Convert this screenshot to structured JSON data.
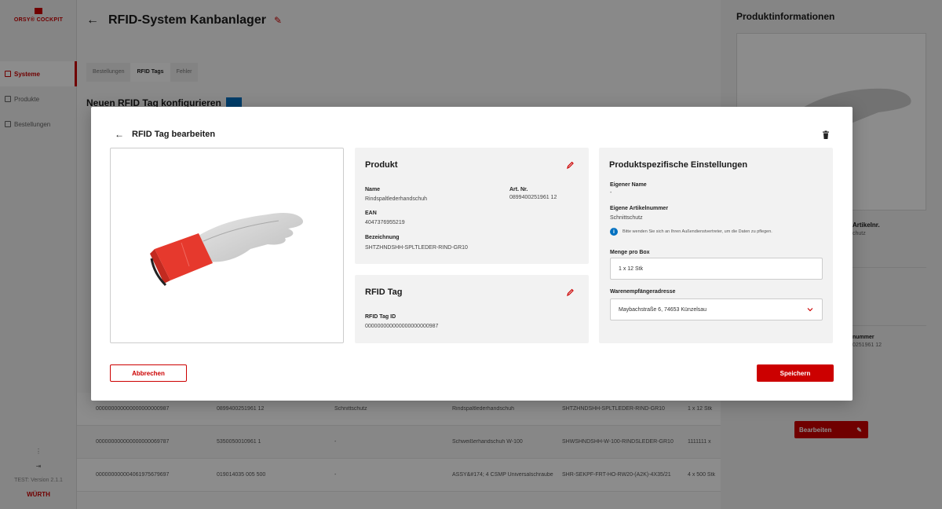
{
  "sidebar": {
    "logo_text": "ORSY® COCKPIT",
    "items": [
      {
        "label": "Systeme"
      },
      {
        "label": "Produkte"
      },
      {
        "label": "Bestellungen"
      }
    ],
    "version": "TEST: Version 2.1.1",
    "brand": "WÜRTH"
  },
  "header": {
    "title": "RFID-System Kanbanlager"
  },
  "tabs": [
    {
      "label": "Bestellungen"
    },
    {
      "label": "RFID Tags"
    },
    {
      "label": "Fehler"
    }
  ],
  "section": {
    "title": "Neuen RFID Tag konfigurieren"
  },
  "table": {
    "rows": [
      {
        "tag": "000000000000000000000987",
        "artnr": "0899400251961   12",
        "custom": "Schnittschutz",
        "name": "Rindspaltlederhandschuh",
        "bez": "SHTZHNDSHH-SPLTLEDER-RIND-GR10",
        "menge": "1 x 12 Stk"
      },
      {
        "tag": "000000000000000000069787",
        "artnr": "5350050010961   1",
        "custom": "-",
        "name": "Schweißerhandschuh W-100",
        "bez": "SHWSHNDSHH-W-100-RINDSLEDER-GR10",
        "menge": "1111111 x"
      },
      {
        "tag": "000000000004061975679697",
        "artnr": "019014035 005  500",
        "custom": "-",
        "name": "ASSY&#174; 4 CSMP Universalschraube",
        "bez": "SHR-SEKPF-FRT-HO-RW20-(A2K)-4X35/21",
        "menge": "4 x 500 Stk"
      }
    ]
  },
  "right_panel": {
    "title": "Produktinformationen",
    "label_a": "Artikelnr.",
    "value_a": "chutz",
    "label_b": "nummer",
    "value_b": "0251961   12",
    "edit_label": "Bearbeiten"
  },
  "modal": {
    "title": "RFID Tag bearbeiten",
    "produkt": {
      "title": "Produkt",
      "name_label": "Name",
      "name_value": "Rindspaltlederhandschuh",
      "artnr_label": "Art. Nr.",
      "artnr_value": "0899400251961   12",
      "ean_label": "EAN",
      "ean_value": "4047376955219",
      "bez_label": "Bezeichnung",
      "bez_value": "SHTZHNDSHH-SPLTLEDER-RIND-GR10"
    },
    "rfid": {
      "title": "RFID Tag",
      "id_label": "RFID Tag ID",
      "id_value": "000000000000000000000987"
    },
    "settings": {
      "title": "Produktspezifische Einstellungen",
      "own_name_label": "Eigener Name",
      "own_name_value": "-",
      "own_artnr_label": "Eigene Artikelnummer",
      "own_artnr_value": "Schnittschutz",
      "info_text": "Bitte wenden Sie sich an Ihren Außendienstvertreter, um die Daten zu pflegen.",
      "menge_label": "Menge pro Box",
      "menge_value": "1 x 12 Stk",
      "address_label": "Warenempfängeradresse",
      "address_value": "Maybachstraße 6, 74653 Künzelsau"
    },
    "cancel_label": "Abbrechen",
    "save_label": "Speichern"
  },
  "colors": {
    "accent": "#cc0000",
    "info": "#0070c0"
  }
}
